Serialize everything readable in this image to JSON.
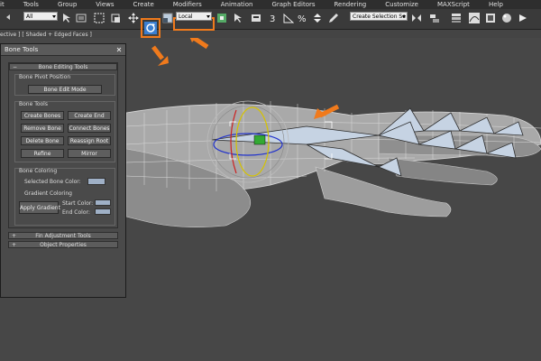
{
  "menu": [
    "it",
    "Tools",
    "Group",
    "Views",
    "Create",
    "Modifiers",
    "Animation",
    "Graph Editors",
    "Rendering",
    "Customize",
    "MAXScript",
    "Help"
  ],
  "toolbar": {
    "selection_filter": "All",
    "coordinate_system": "Local",
    "named_selection_placeholder": "Create Selection Se"
  },
  "viewport": {
    "label": "ective ] [ Shaded + Edged Faces ]"
  },
  "bone_tools": {
    "title": "Bone Tools",
    "rollout_editing": "Bone Editing Tools",
    "pivot_group": "Bone Pivot Position",
    "bone_edit_mode": "Bone Edit Mode",
    "bone_tools_group": "Bone Tools",
    "create_bones": "Create Bones",
    "create_end": "Create End",
    "remove_bone": "Remove Bone",
    "connect_bones": "Connect Bones",
    "delete_bone": "Delete Bone",
    "reassign_root": "Reassign Root",
    "refine": "Refine",
    "mirror": "Mirror",
    "coloring_group": "Bone Coloring",
    "selected_bone_color": "Selected Bone Color:",
    "gradient_coloring": "Gradient Coloring",
    "apply_gradient": "Apply Gradient",
    "start_color": "Start Color:",
    "end_color": "End Color:",
    "rollout_fin": "Fin Adjustment Tools",
    "rollout_props": "Object Properties"
  },
  "colors": {
    "highlight": "#f07a1c",
    "swatch": "#9fb0c6"
  }
}
